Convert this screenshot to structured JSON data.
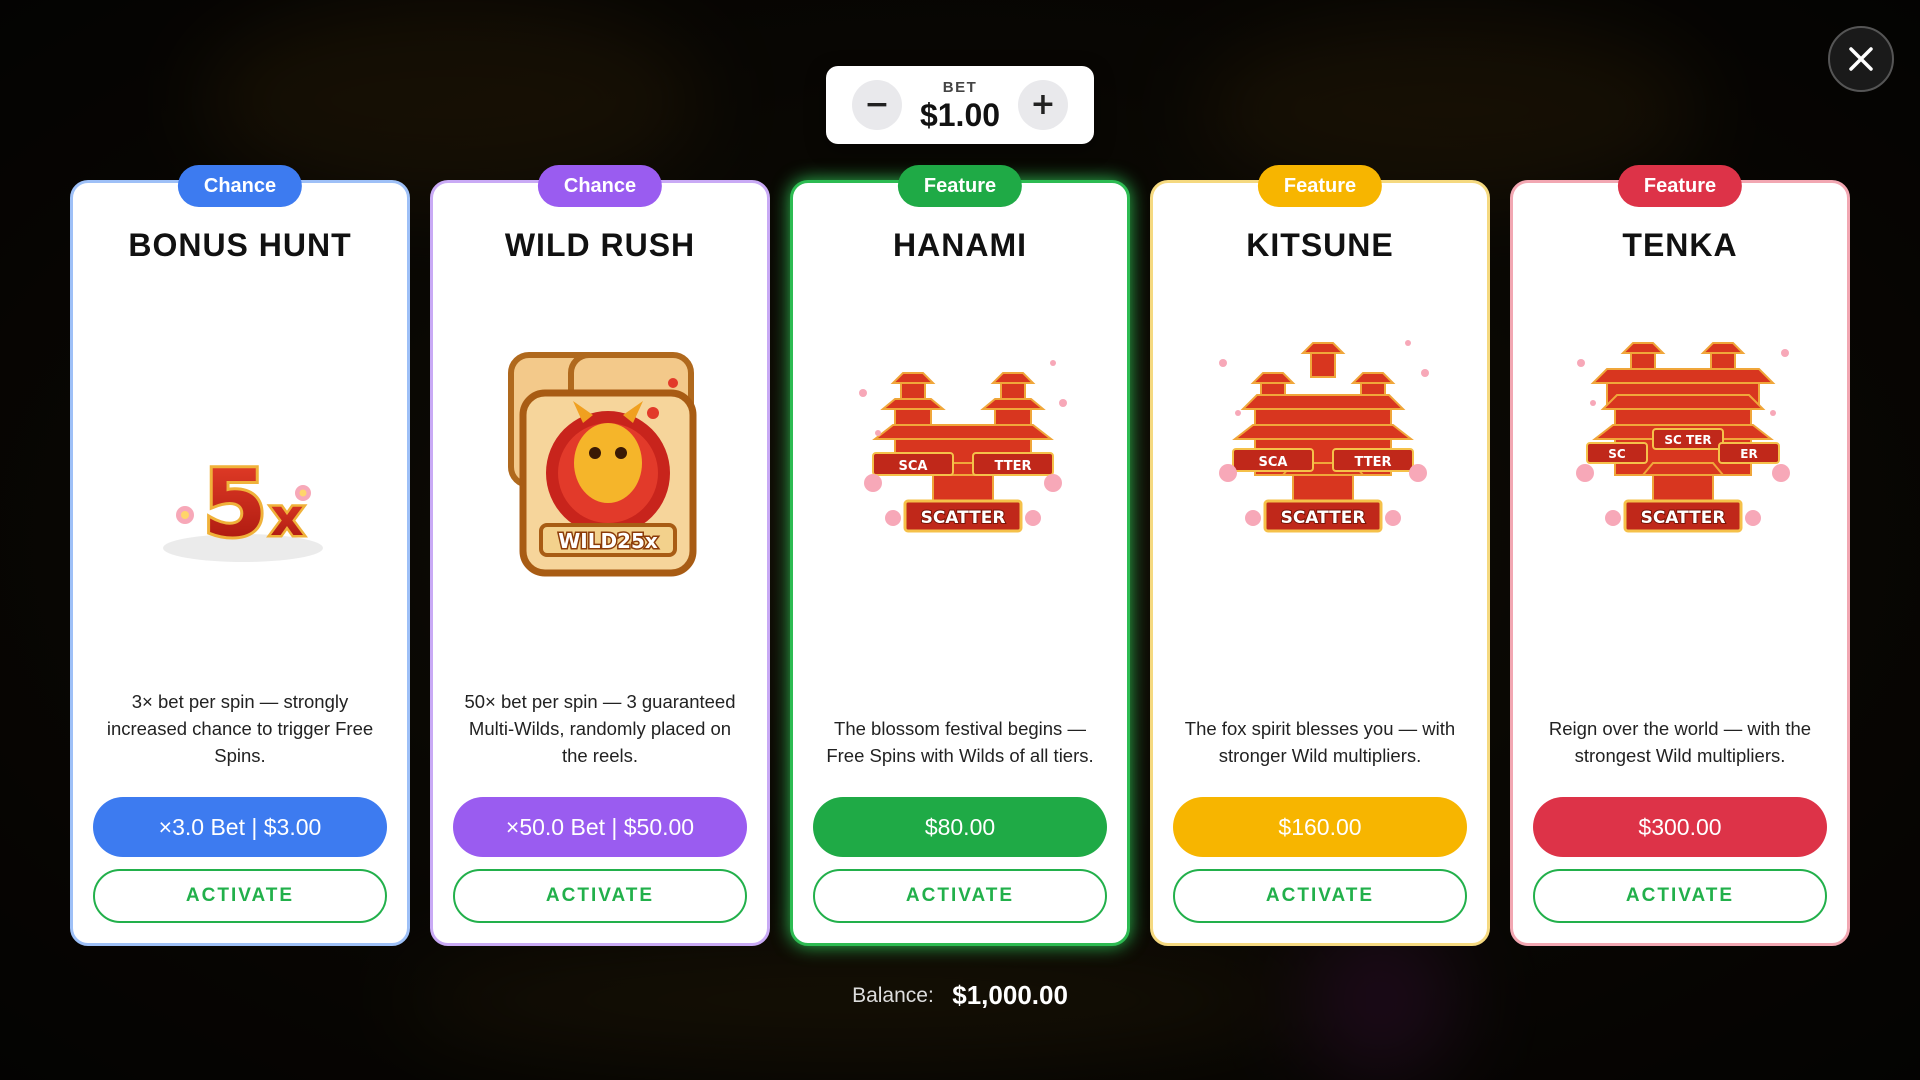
{
  "bet": {
    "label": "BET",
    "value": "$1.00",
    "minus": "−",
    "plus": "+"
  },
  "close_icon": "close-icon",
  "cards": [
    {
      "tag": "Chance",
      "title": "BONUS HUNT",
      "art": "5x-multiplier-symbol",
      "description": "3× bet per spin — strongly increased chance to trigger Free Spins.",
      "price": "×3.0 Bet | $3.00",
      "action": "ACTIVATE",
      "tag_color": "#3d7bf0",
      "border_color": "#9ec0f7",
      "price_color": "#3d7bf0"
    },
    {
      "tag": "Chance",
      "title": "WILD RUSH",
      "art": "dragon-wild-symbols",
      "description": "50× bet per spin — 3 guaranteed Multi-Wilds, randomly placed on the reels.",
      "price": "×50.0 Bet | $50.00",
      "action": "ACTIVATE",
      "tag_color": "#9a5cf0",
      "border_color": "#c9aaf5",
      "price_color": "#9a5cf0"
    },
    {
      "tag": "Feature",
      "title": "HANAMI",
      "art": "scatter-pagodas-2",
      "description": "The blossom festival begins — Free Spins with Wilds of all tiers.",
      "price": "$80.00",
      "action": "ACTIVATE",
      "tag_color": "#1faa46",
      "border_color": "#2dbb52",
      "price_color": "#1faa46"
    },
    {
      "tag": "Feature",
      "title": "KITSUNE",
      "art": "scatter-pagodas-3",
      "description": "The fox spirit blesses you — with stronger Wild multipliers.",
      "price": "$160.00",
      "action": "ACTIVATE",
      "tag_color": "#f7b500",
      "border_color": "#f5d980",
      "price_color": "#f7b500"
    },
    {
      "tag": "Feature",
      "title": "TENKA",
      "art": "scatter-pagodas-4",
      "description": "Reign over the world — with the strongest Wild multipliers.",
      "price": "$300.00",
      "action": "ACTIVATE",
      "tag_color": "#dd3348",
      "border_color": "#f2a7b2",
      "price_color": "#dd3348"
    }
  ],
  "balance": {
    "label": "Balance:",
    "value": "$1,000.00"
  }
}
